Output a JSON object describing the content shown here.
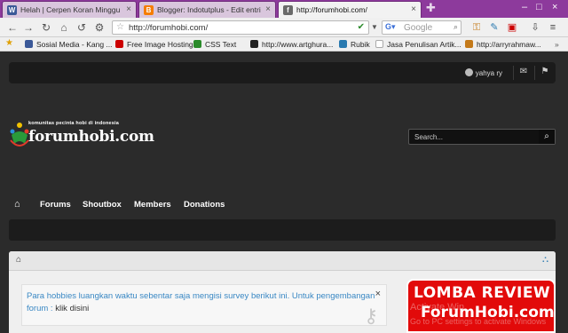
{
  "browser": {
    "tabs": [
      {
        "title": "Helah | Cerpen Koran Minggu",
        "favicon": "W",
        "color": "#3b5998"
      },
      {
        "title": "Blogger: Indotutplus - Edit entri",
        "favicon": "B",
        "color": "#f57d00"
      },
      {
        "title": "http://forumhobi.com/",
        "favicon": "f",
        "color": "#6a6a6a"
      }
    ],
    "url": "http://forumhobi.com/",
    "search_placeholder": "Google",
    "bookmarks": [
      {
        "label": "Sosial Media - Kang ...",
        "color": "#3b5998"
      },
      {
        "label": "Free Image Hosting ...",
        "color": "#c00"
      },
      {
        "label": "CSS Text",
        "color": "#2a8a2a"
      },
      {
        "label": "http://www.artghura...",
        "color": "#222"
      },
      {
        "label": "Rubik",
        "color": "#2a7ab0"
      },
      {
        "label": "Jasa Penulisan Artik...",
        "color": "#888"
      },
      {
        "label": "http://arryrahmaw...",
        "color": "#c47a1a"
      }
    ]
  },
  "site": {
    "topbar": {
      "username": "yahya ry"
    },
    "logo": {
      "tagline": "komunitas pecinta hobi di indonesia",
      "name": "forumhobi.com"
    },
    "search": {
      "placeholder": "Search..."
    },
    "nav": [
      "Forums",
      "Shoutbox",
      "Members",
      "Donations"
    ],
    "notice": {
      "text": "Para hobbies luangkan waktu sebentar saja mengisi survey berikut ini. Untuk pengembangan forum :",
      "link": "klik disini"
    },
    "promo": {
      "line1": "LOMBA REVIEW",
      "line2": "ForumHobi.com",
      "watermark1": "Activate Win",
      "watermark2": "Go to PC settings to activate Windows"
    }
  },
  "colors": {
    "accent_tabstrip": "#8d3a9c",
    "promo_red": "#e20a0a",
    "notice_text": "#3a88c4"
  }
}
